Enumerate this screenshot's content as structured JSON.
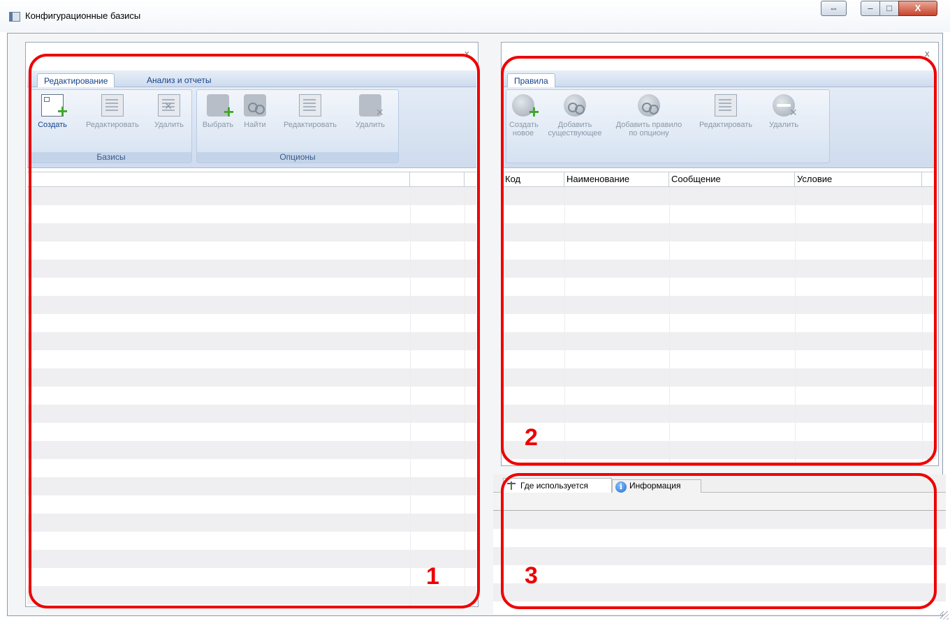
{
  "window": {
    "title": "Конфигурационные базисы",
    "restore_glyph": "⇔",
    "minimize_glyph": "–",
    "maximize_glyph": "□",
    "close_glyph": "X"
  },
  "left_panel": {
    "close_glyph": "x",
    "tabs": [
      "Редактирование",
      "Анализ и отчеты"
    ],
    "groups": [
      {
        "label": "Базисы",
        "buttons": [
          "Создать",
          "Редактировать",
          "Удалить"
        ]
      },
      {
        "label": "Опционы",
        "buttons": [
          "Выбрать",
          "Найти",
          "Редактировать",
          "Удалить"
        ]
      }
    ]
  },
  "rules_panel": {
    "close_glyph": "x",
    "tab": "Правила",
    "buttons": [
      {
        "line1": "Создать",
        "line2": "новое"
      },
      {
        "line1": "Добавить",
        "line2": "существующее"
      },
      {
        "line1": "Добавить правило",
        "line2": "по опциону"
      },
      {
        "line1": "Редактировать",
        "line2": ""
      },
      {
        "line1": "Удалить",
        "line2": ""
      }
    ],
    "columns": [
      "Код",
      "Наименование",
      "Сообщение",
      "Условие"
    ]
  },
  "bottom_panel": {
    "tabs": [
      "Где используется",
      "Информация"
    ]
  },
  "annotations": [
    "1",
    "2",
    "3"
  ],
  "colors": {
    "annotation": "#ee0000",
    "ribbon_text": "#15428b"
  }
}
